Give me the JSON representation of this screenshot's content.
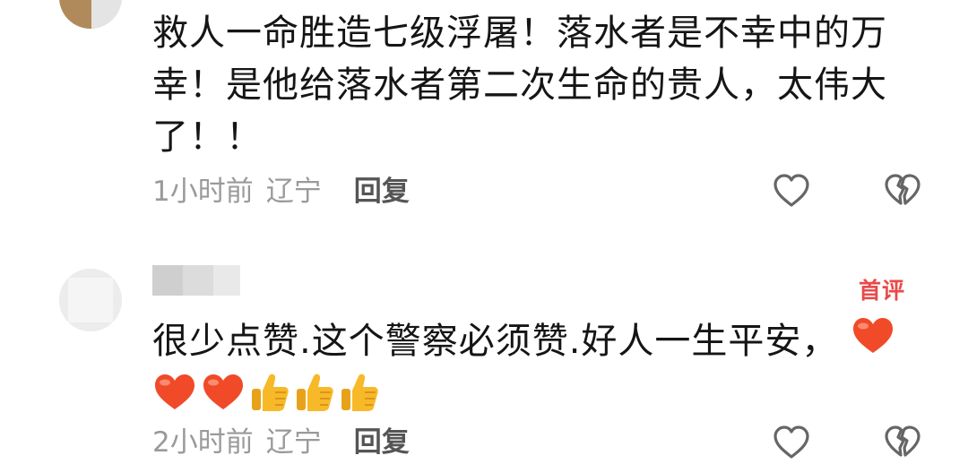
{
  "comments": [
    {
      "text_line1": "救人一命胜造七级浮屠！落水者是不幸中的万",
      "text_line2": "幸！是他给落水者第二次生命的贵人，太伟大",
      "text_line3": "了！！",
      "time": "1小时前",
      "location": "辽宁",
      "reply_label": "回复"
    },
    {
      "badge": "首评",
      "text_line1": "很少点赞.这个警察必须赞.好人一生平安，",
      "emojis_line1": [
        "heart-emoji"
      ],
      "emojis_line2": [
        "heart-emoji",
        "heart-emoji",
        "thumbs-up-emoji",
        "thumbs-up-emoji",
        "thumbs-up-emoji"
      ],
      "time": "2小时前",
      "location": "辽宁",
      "reply_label": "回复"
    }
  ],
  "colors": {
    "text": "#151515",
    "meta": "#9a9a9a",
    "reply": "#555555",
    "badge": "#e84a4a",
    "heart": "#f04a28",
    "thumb": "#f7b928"
  }
}
